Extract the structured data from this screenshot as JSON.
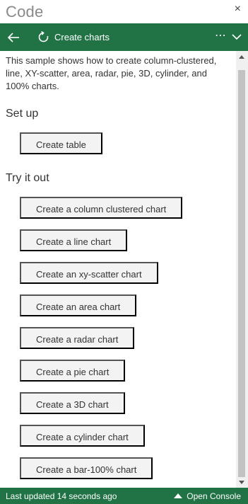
{
  "window": {
    "title": "Code",
    "close_glyph": "×"
  },
  "command_bar": {
    "sample_title": "Create charts",
    "more_glyph": "⋯",
    "icons": [
      "back-arrow-icon",
      "refresh-icon",
      "more-icon",
      "chevron-down-icon"
    ]
  },
  "description": "This sample shows how to create column-clustered, line, XY-scatter, area, radar, pie, 3D, cylinder, and 100% charts.",
  "setup": {
    "heading": "Set up",
    "buttons": [
      {
        "label": "Create table"
      }
    ]
  },
  "try_it_out": {
    "heading": "Try it out",
    "buttons": [
      {
        "label": "Create a column clustered chart"
      },
      {
        "label": "Create a line chart"
      },
      {
        "label": "Create an xy-scatter chart"
      },
      {
        "label": "Create an area chart"
      },
      {
        "label": "Create a radar chart"
      },
      {
        "label": "Create a pie chart"
      },
      {
        "label": "Create a 3D chart"
      },
      {
        "label": "Create a cylinder chart"
      },
      {
        "label": "Create a bar-100% chart"
      }
    ]
  },
  "footer": {
    "status": "Last updated 14 seconds ago",
    "console_label": "Open Console"
  },
  "colors": {
    "brand_green": "#217346",
    "button_bg": "#f3f3f3",
    "text": "#333333"
  }
}
